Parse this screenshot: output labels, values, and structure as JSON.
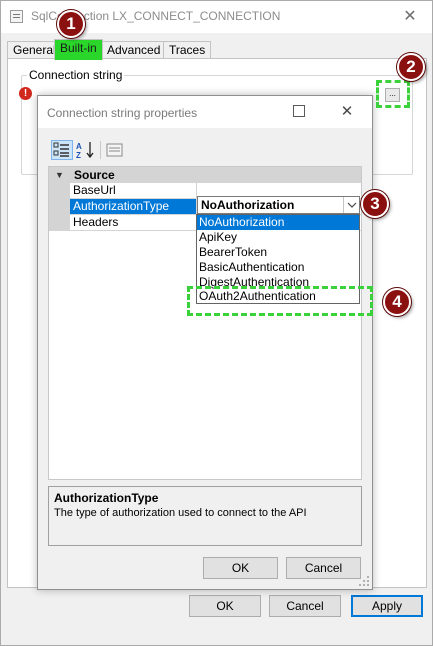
{
  "outer_window": {
    "title": "SqlConnection LX_CONNECT_CONNECTION",
    "close_glyph": "✕",
    "tabs": [
      {
        "label": "General"
      },
      {
        "label": "Built-in"
      },
      {
        "label": "Advanced"
      },
      {
        "label": "Traces"
      }
    ],
    "connection_group_label": "Connection string",
    "error_glyph": "!",
    "ellipsis_label": "...",
    "buttons": {
      "ok": "OK",
      "cancel": "Cancel",
      "apply": "Apply"
    }
  },
  "inner_dialog": {
    "title": "Connection string properties",
    "close_glyph": "✕",
    "property_grid": {
      "category": {
        "label": "Source",
        "toggle_glyph": "▼"
      },
      "rows": [
        {
          "name": "BaseUrl",
          "value": ""
        },
        {
          "name": "AuthorizationType",
          "value": "NoAuthorization"
        },
        {
          "name": "Headers",
          "value": ""
        }
      ]
    },
    "authorization_dropdown": {
      "selected": "NoAuthorization",
      "options": [
        "NoAuthorization",
        "ApiKey",
        "BearerToken",
        "BasicAuthentication",
        "DigestAuthentication",
        "OAuth2Authentication"
      ]
    },
    "help": {
      "title": "AuthorizationType",
      "description": "The type of authorization used to connect to the API"
    },
    "buttons": {
      "ok": "OK",
      "cancel": "Cancel"
    }
  },
  "annotations": [
    {
      "number": "1"
    },
    {
      "number": "2"
    },
    {
      "number": "3"
    },
    {
      "number": "4"
    }
  ],
  "colors": {
    "highlight_green": "#2ad62a",
    "callout_dash_green": "#3ad13a",
    "badge_red": "#8b1010",
    "selection_blue": "#0078d7",
    "error_red": "#d0281c"
  }
}
